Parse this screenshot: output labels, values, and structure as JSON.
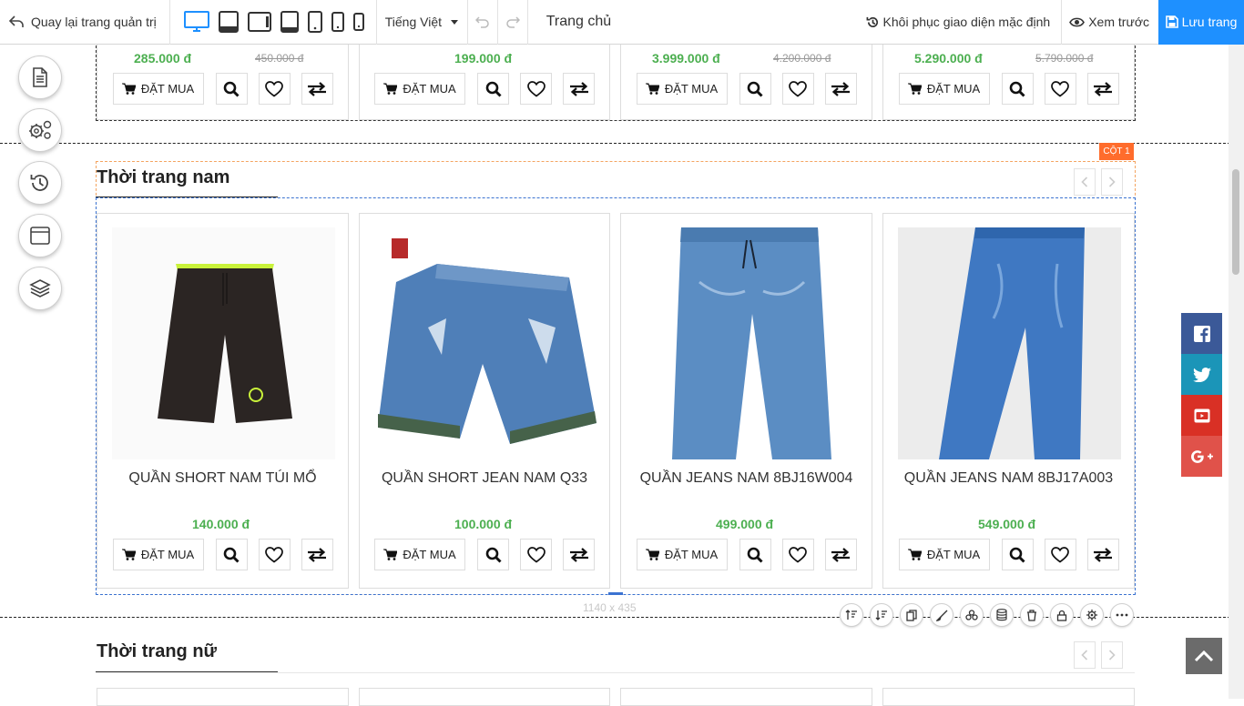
{
  "topbar": {
    "back_label": "Quay lại trang quản trị",
    "language": "Tiếng Việt",
    "page_name": "Trang chủ",
    "restore_label": "Khôi phục giao diện mặc định",
    "preview_label": "Xem trước",
    "save_label": "Lưu trang",
    "devices": [
      "desktop-icon",
      "laptop-icon",
      "tablet-landscape-icon",
      "tablet-icon",
      "phone-icon",
      "phone-small-icon",
      "phone-tiny-icon"
    ],
    "active_device": "desktop-icon",
    "save_color": "#1e90ff"
  },
  "side_tools": [
    "document-icon",
    "settings-gears-icon",
    "history-icon",
    "window-icon",
    "layers-icon"
  ],
  "top_row": {
    "buy_label": "ĐẶT MUA",
    "products": [
      {
        "price": "285.000 đ",
        "old_price": "450.000 đ"
      },
      {
        "price": "199.000 đ",
        "old_price": ""
      },
      {
        "price": "3.999.000 đ",
        "old_price": "4.200.000 đ"
      },
      {
        "price": "5.290.000 đ",
        "old_price": "5.790.000 đ"
      }
    ]
  },
  "men_section": {
    "title": "Thời trang nam",
    "column_badge": "CỘT 1",
    "dimension": "1140 x 435",
    "buy_label": "ĐẶT MUA",
    "products": [
      {
        "name": "QUẦN SHORT NAM TÚI MỔ",
        "price": "140.000 đ"
      },
      {
        "name": "QUẦN SHORT JEAN NAM Q33",
        "price": "100.000 đ"
      },
      {
        "name": "QUẦN JEANS NAM 8BJ16W004",
        "price": "499.000 đ"
      },
      {
        "name": "QUẦN JEANS NAM 8BJ17A003",
        "price": "549.000 đ"
      }
    ]
  },
  "women_section": {
    "title": "Thời trang nữ"
  },
  "mini_toolbar": [
    "sort-up-icon",
    "sort-down-icon",
    "copy-icon",
    "brush-icon",
    "group-icon",
    "database-icon",
    "trash-icon",
    "lock-icon",
    "gear-icon",
    "more-icon"
  ],
  "social": [
    {
      "name": "facebook-icon",
      "color": "#3b5998"
    },
    {
      "name": "twitter-icon",
      "color": "#1b95b8"
    },
    {
      "name": "youtube-icon",
      "color": "#d93025"
    },
    {
      "name": "google-plus-icon",
      "color": "#e0524a"
    }
  ]
}
